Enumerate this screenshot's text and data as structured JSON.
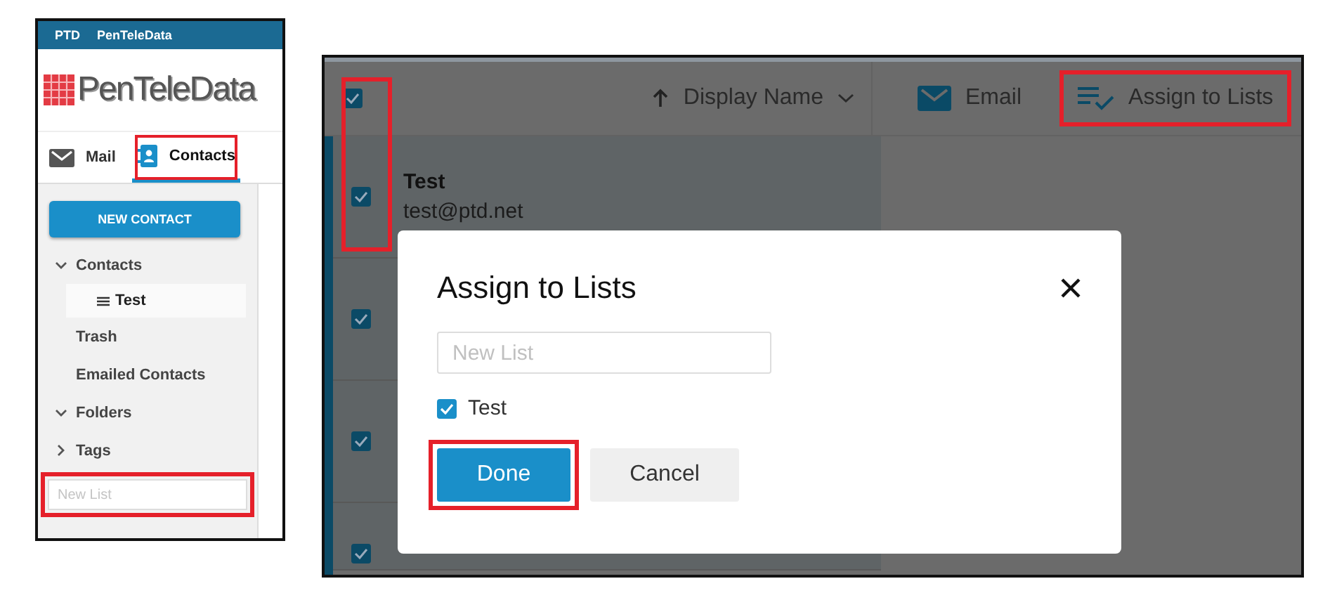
{
  "left_app": {
    "top_bar": [
      "PTD",
      "PenTeleData"
    ],
    "logo": "PenTeleData",
    "tabs": [
      {
        "label": "Mail",
        "selected": false,
        "highlighted": false
      },
      {
        "label": "Contacts",
        "selected": true,
        "highlighted": true
      }
    ],
    "new_contact_button": "NEW CONTACT",
    "tree": [
      {
        "label": "Contacts",
        "expanded": true,
        "children": [
          {
            "label": "Test",
            "selected": true
          }
        ]
      },
      {
        "label": "Trash"
      },
      {
        "label": "Emailed Contacts"
      },
      {
        "label": "Folders",
        "expanded": true
      },
      {
        "label": "Tags",
        "expanded": false
      }
    ],
    "new_list_field": {
      "placeholder": "New List",
      "highlighted": true
    }
  },
  "right_app": {
    "header": {
      "select_all_checked": true,
      "sort_label": "Display Name",
      "actions": [
        {
          "label": "Email",
          "highlighted": false
        },
        {
          "label": "Assign to Lists",
          "highlighted": true
        }
      ]
    },
    "checkbox_column_highlighted": true,
    "rows": [
      {
        "name": "Test",
        "email": "test@ptd.net",
        "checked": true
      },
      {
        "checked": true
      },
      {
        "checked": true
      },
      {
        "checked": true
      }
    ],
    "dialog": {
      "title": "Assign to Lists",
      "new_list_placeholder": "New List",
      "lists": [
        {
          "label": "Test",
          "checked": true
        }
      ],
      "buttons": [
        {
          "label": "Done",
          "kind": "primary",
          "highlighted": true
        },
        {
          "label": "Cancel",
          "kind": "secondary",
          "highlighted": false
        }
      ]
    }
  }
}
